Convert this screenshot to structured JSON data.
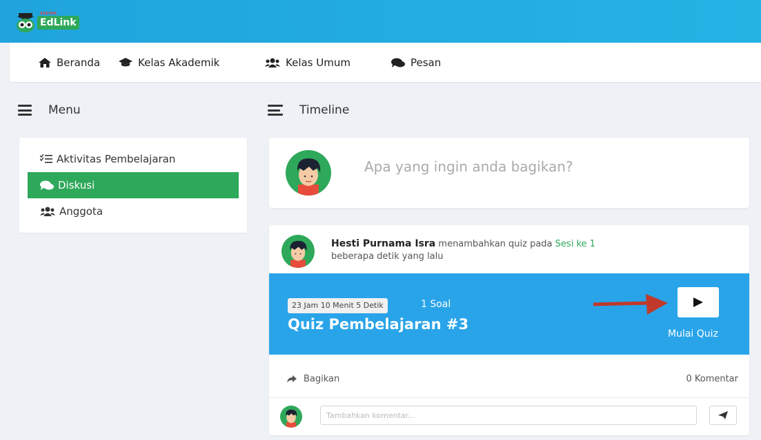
{
  "brand": {
    "logo_text": "EdLink",
    "logo_sub": "SEVIMA"
  },
  "nav": {
    "items": [
      {
        "label": "Beranda",
        "icon": "home-icon"
      },
      {
        "label": "Kelas Akademik",
        "icon": "graduation-cap-icon"
      },
      {
        "label": "Kelas Umum",
        "icon": "users-icon"
      },
      {
        "label": "Pesan",
        "icon": "comments-icon"
      }
    ]
  },
  "sidebar": {
    "title": "Menu",
    "items": [
      {
        "label": "Aktivitas Pembelajaran",
        "icon": "tasks-icon",
        "active": false
      },
      {
        "label": "Diskusi",
        "icon": "comments-icon",
        "active": true
      },
      {
        "label": "Anggota",
        "icon": "users-icon",
        "active": false
      }
    ]
  },
  "timeline": {
    "title": "Timeline",
    "post_placeholder": "Apa yang ingin anda bagikan?",
    "post": {
      "author": "Hesti Purnama Isra",
      "action": "menambahkan quiz pada",
      "session": "Sesi ke 1",
      "time": "beberapa detik yang lalu",
      "quiz": {
        "timer": "23 Jam 10 Menit 5 Detik",
        "count": "1 Soal",
        "title": "Quiz Pembelajaran #3",
        "start_label": "Mulai Quiz"
      },
      "share_label": "Bagikan",
      "comments_label": "0 Komentar",
      "comment_placeholder": "Tambahkan komentar..."
    }
  },
  "colors": {
    "accent": "#2ea85a",
    "header": "#1fa4dd",
    "quiz_banner": "#29a4e9",
    "arrow": "#c0392b"
  }
}
